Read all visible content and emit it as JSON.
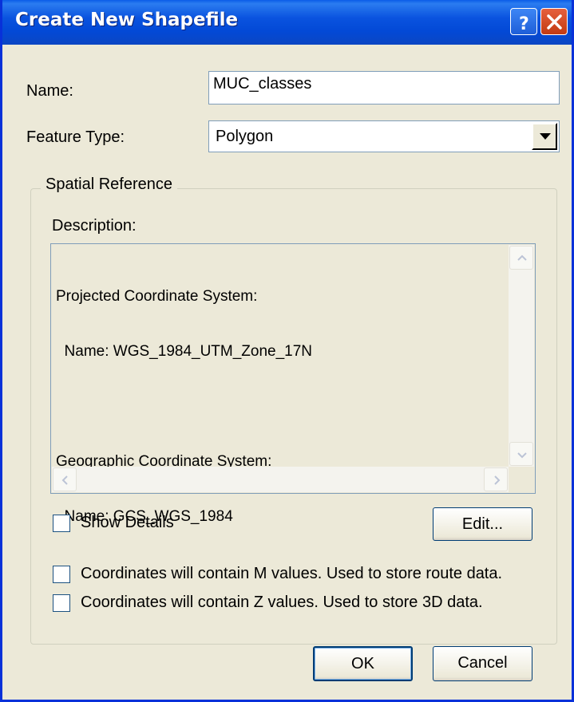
{
  "window": {
    "title": "Create New Shapefile",
    "help_icon": "help-icon",
    "close_icon": "close-icon"
  },
  "form": {
    "name_label": "Name:",
    "name_value": "MUC_classes",
    "feature_type_label": "Feature Type:",
    "feature_type_value": "Polygon"
  },
  "spatial_reference": {
    "group_label": "Spatial Reference",
    "description_label": "Description:",
    "description_lines": [
      "Projected Coordinate System:",
      "  Name: WGS_1984_UTM_Zone_17N",
      "",
      "Geographic Coordinate System:",
      "  Name: GCS_WGS_1984"
    ],
    "show_details_label": "Show Details",
    "edit_label": "Edit..."
  },
  "options": {
    "m_values_label": "Coordinates will contain M values. Used to store route data.",
    "z_values_label": "Coordinates will contain Z values. Used to store 3D data."
  },
  "buttons": {
    "ok": "OK",
    "cancel": "Cancel"
  },
  "colors": {
    "titlebar": "#0349d6",
    "dialog_bg": "#ece9d8",
    "close_button": "#c23a12"
  }
}
